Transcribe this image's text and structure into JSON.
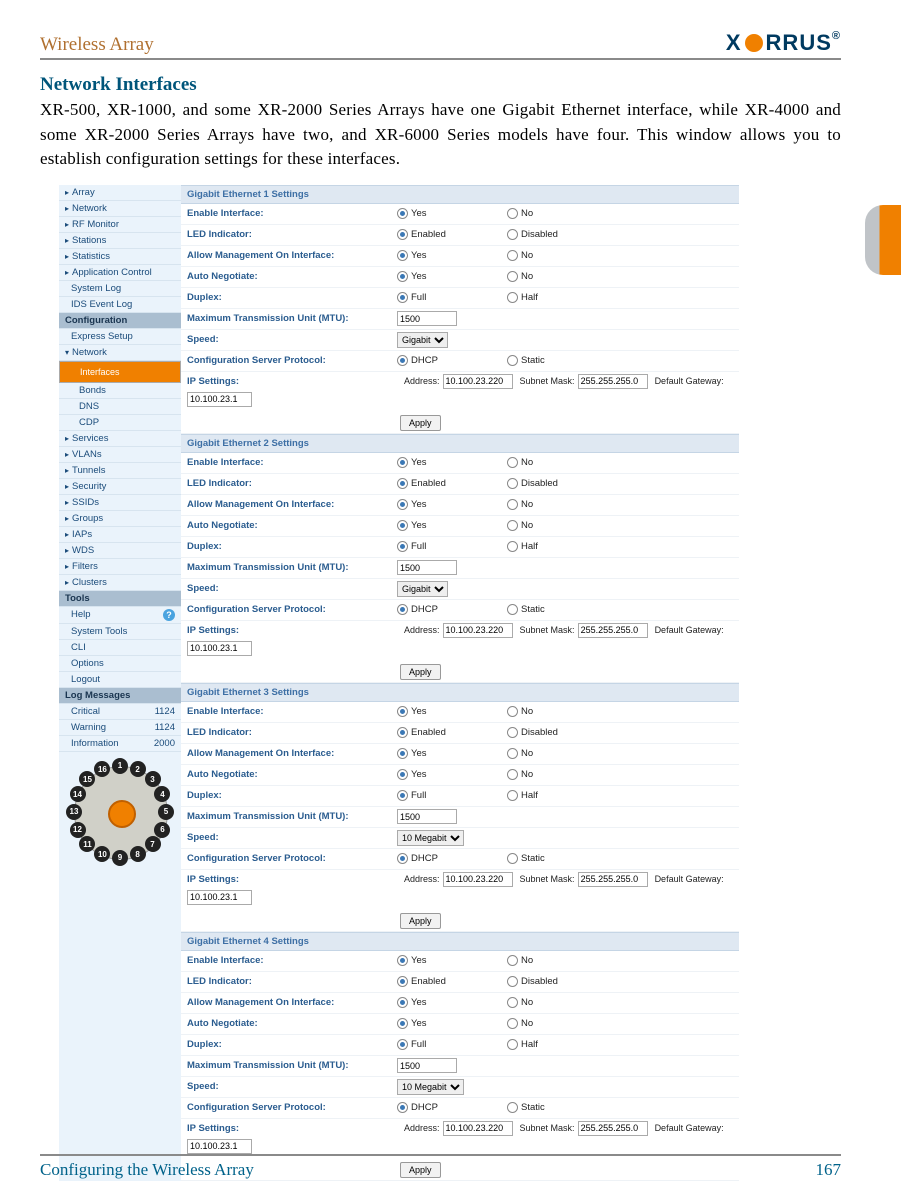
{
  "header": {
    "doc_title": "Wireless Array",
    "logo_text": "XIRRUS"
  },
  "section": {
    "heading": "Network Interfaces",
    "paragraph": "XR-500, XR-1000, and some XR-2000 Series Arrays have one Gigabit Ethernet interface, while XR-4000 and some XR-2000 Series Arrays have two, and XR-6000 Series models have four. This window allows you to establish configuration settings for these interfaces."
  },
  "sidebar": {
    "items_top": [
      "Array",
      "Network",
      "RF Monitor",
      "Stations",
      "Statistics",
      "Application Control",
      "System Log",
      "IDS Event Log"
    ],
    "group_config": "Configuration",
    "config_items": [
      "Express Setup",
      "Network"
    ],
    "net_children": [
      "Interfaces",
      "Bonds",
      "DNS",
      "CDP"
    ],
    "items_mid": [
      "Services",
      "VLANs",
      "Tunnels",
      "Security",
      "SSIDs",
      "Groups",
      "IAPs",
      "WDS",
      "Filters",
      "Clusters"
    ],
    "group_tools": "Tools",
    "tools_items": [
      "Help",
      "System Tools",
      "CLI",
      "Options",
      "Logout"
    ],
    "group_log": "Log Messages",
    "log_items": [
      {
        "label": "Critical",
        "count": "1124"
      },
      {
        "label": "Warning",
        "count": "1124"
      },
      {
        "label": "Information",
        "count": "2000"
      }
    ]
  },
  "labels": {
    "enable": "Enable Interface:",
    "led": "LED Indicator:",
    "mgmt": "Allow Management On Interface:",
    "auto": "Auto Negotiate:",
    "duplex": "Duplex:",
    "mtu": "Maximum Transmission Unit (MTU):",
    "speed": "Speed:",
    "proto": "Configuration Server Protocol:",
    "ip": "IP Settings:",
    "yes": "Yes",
    "no": "No",
    "enabled": "Enabled",
    "disabled": "Disabled",
    "full": "Full",
    "half": "Half",
    "dhcp": "DHCP",
    "static": "Static",
    "addr": "Address:",
    "mask": "Subnet Mask:",
    "gw": "Default Gateway:",
    "apply": "Apply"
  },
  "interfaces": [
    {
      "title": "Gigabit Ethernet 1 Settings",
      "mtu": "1500",
      "speed": "Gigabit",
      "addr": "10.100.23.220",
      "mask": "255.255.255.0",
      "gw": "10.100.23.1"
    },
    {
      "title": "Gigabit Ethernet 2 Settings",
      "mtu": "1500",
      "speed": "Gigabit",
      "addr": "10.100.23.220",
      "mask": "255.255.255.0",
      "gw": "10.100.23.1"
    },
    {
      "title": "Gigabit Ethernet 3 Settings",
      "mtu": "1500",
      "speed": "10 Megabit",
      "addr": "10.100.23.220",
      "mask": "255.255.255.0",
      "gw": "10.100.23.1"
    },
    {
      "title": "Gigabit Ethernet 4 Settings",
      "mtu": "1500",
      "speed": "10 Megabit",
      "addr": "10.100.23.220",
      "mask": "255.255.255.0",
      "gw": "10.100.23.1"
    }
  ],
  "footer": {
    "text": "Configuring the Wireless Array",
    "page": "167"
  }
}
